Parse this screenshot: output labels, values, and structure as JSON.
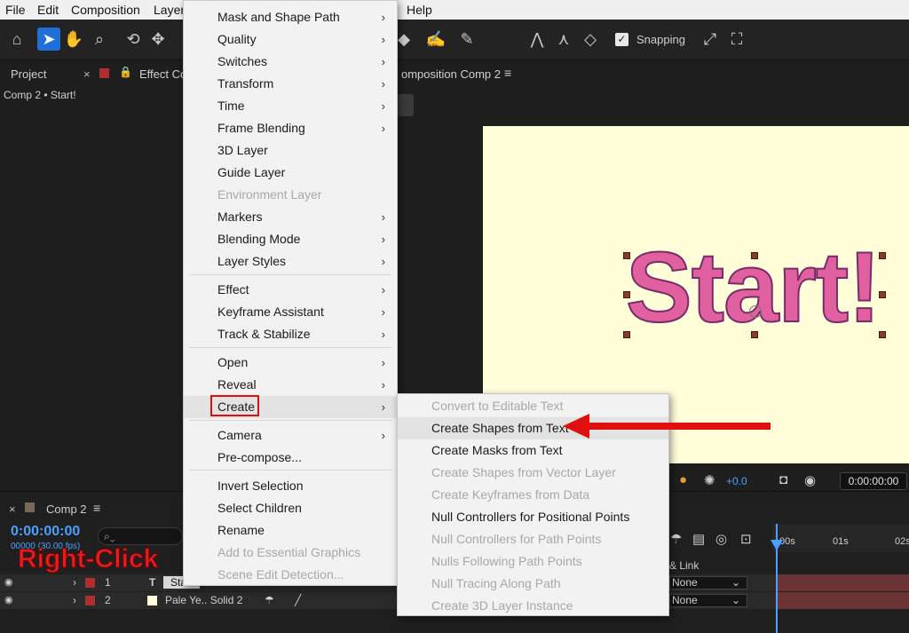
{
  "menubar": {
    "items": [
      "File",
      "Edit",
      "Composition",
      "Layer",
      "Help"
    ]
  },
  "toolbar": {
    "snapping_label": "Snapping",
    "snapping_checked": true
  },
  "left_panel": {
    "tabs": [
      "Project",
      "Effect Co"
    ],
    "breadcrumb": "Comp 2 • Start!"
  },
  "viewer": {
    "tab": "omposition Comp 2",
    "canvas_text": "Start!",
    "zoom_value": "+0.0",
    "timecode": "0:00:00:00",
    "canvas_bg": "#fffed9",
    "text_fill": "#e060a0"
  },
  "timeline": {
    "comp_title": "Comp 2",
    "timecode": "0:00:00:00",
    "frames_fps": "00000 (30.00 fps)",
    "search_placeholder": "",
    "ruler_ticks": [
      "00s",
      "01s",
      "02s"
    ],
    "annotation": "Right-Click",
    "column_header": "& Link",
    "rows": [
      {
        "num": "1",
        "name": "Start",
        "type_icon": "T",
        "parent": "None"
      },
      {
        "num": "2",
        "name": "Pale Ye.. Solid 2",
        "parent": "None"
      }
    ]
  },
  "layer_menu": {
    "items": [
      {
        "label": "Mask and Shape Path",
        "submenu": true,
        "disabled": false
      },
      {
        "label": "Quality",
        "submenu": true,
        "disabled": false
      },
      {
        "label": "Switches",
        "submenu": true,
        "disabled": false
      },
      {
        "label": "Transform",
        "submenu": true,
        "disabled": false
      },
      {
        "label": "Time",
        "submenu": true,
        "disabled": false
      },
      {
        "label": "Frame Blending",
        "submenu": true,
        "disabled": false
      },
      {
        "label": "3D Layer",
        "submenu": false,
        "disabled": false
      },
      {
        "label": "Guide Layer",
        "submenu": false,
        "disabled": false
      },
      {
        "label": "Environment Layer",
        "submenu": false,
        "disabled": true
      },
      {
        "label": "Markers",
        "submenu": true,
        "disabled": false
      },
      {
        "label": "Blending Mode",
        "submenu": true,
        "disabled": false
      },
      {
        "label": "Layer Styles",
        "submenu": true,
        "disabled": false
      },
      {
        "label": "Effect",
        "submenu": true,
        "disabled": false
      },
      {
        "label": "Keyframe Assistant",
        "submenu": true,
        "disabled": false
      },
      {
        "label": "Track & Stabilize",
        "submenu": true,
        "disabled": false
      },
      {
        "label": "Open",
        "submenu": true,
        "disabled": false
      },
      {
        "label": "Reveal",
        "submenu": true,
        "disabled": false
      },
      {
        "label": "Create",
        "submenu": true,
        "disabled": false,
        "highlighted": true
      },
      {
        "label": "Camera",
        "submenu": true,
        "disabled": false
      },
      {
        "label": "Pre-compose...",
        "submenu": false,
        "disabled": false
      },
      {
        "label": "Invert Selection",
        "submenu": false,
        "disabled": false
      },
      {
        "label": "Select Children",
        "submenu": false,
        "disabled": false
      },
      {
        "label": "Rename",
        "submenu": false,
        "disabled": false
      },
      {
        "label": "Add to Essential Graphics",
        "submenu": false,
        "disabled": true
      },
      {
        "label": "Scene Edit Detection...",
        "submenu": false,
        "disabled": true
      }
    ]
  },
  "create_submenu": {
    "items": [
      {
        "label": "Convert to Editable Text",
        "disabled": true
      },
      {
        "label": "Create Shapes from Text",
        "disabled": false,
        "highlighted": true
      },
      {
        "label": "Create Masks from Text",
        "disabled": false
      },
      {
        "label": "Create Shapes from Vector Layer",
        "disabled": true
      },
      {
        "label": "Create Keyframes from Data",
        "disabled": true
      },
      {
        "label": "Null Controllers for Positional Points",
        "disabled": false
      },
      {
        "label": "Null Controllers for Path Points",
        "disabled": true
      },
      {
        "label": "Nulls Following Path Points",
        "disabled": true
      },
      {
        "label": "Null Tracing Along Path",
        "disabled": true
      },
      {
        "label": "Create 3D Layer Instance",
        "disabled": true
      }
    ]
  },
  "colors": {
    "accent_blue": "#4aa0ff",
    "annotation_red": "#e01010"
  }
}
